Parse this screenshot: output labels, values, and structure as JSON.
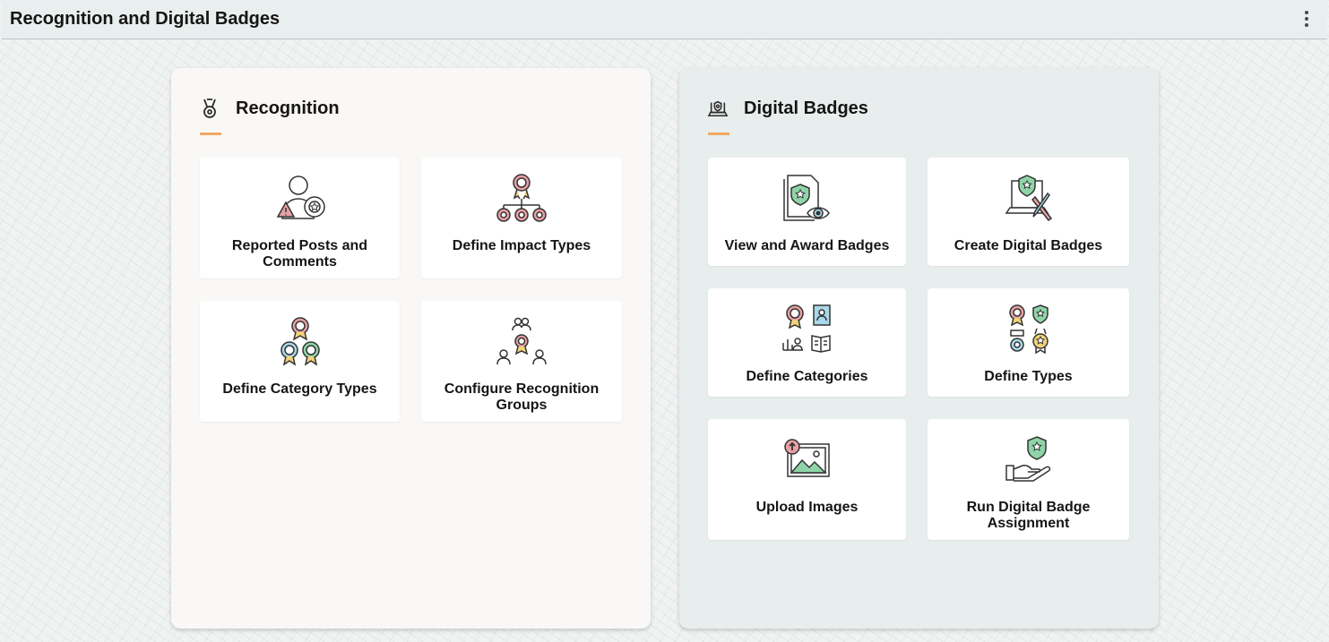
{
  "header": {
    "title": "Recognition and Digital Badges",
    "menu_icon": "kebab-menu-icon"
  },
  "recognition": {
    "title": "Recognition",
    "icon": "medal-icon",
    "tiles": [
      {
        "label": "Reported Posts and Comments",
        "icon": "reported-user-icon"
      },
      {
        "label": "Define Impact Types",
        "icon": "impact-hierarchy-icon"
      },
      {
        "label": "Define Category Types",
        "icon": "category-badges-icon"
      },
      {
        "label": "Configure Recognition Groups",
        "icon": "recognition-groups-icon"
      }
    ]
  },
  "badges": {
    "title": "Digital Badges",
    "icon": "badge-laptop-icon",
    "tiles": [
      {
        "label": "View and Award Badges",
        "icon": "view-badge-icon"
      },
      {
        "label": "Create Digital Badges",
        "icon": "create-badge-icon"
      },
      {
        "label": "Define Categories",
        "icon": "categories-icon"
      },
      {
        "label": "Define Types",
        "icon": "badge-types-icon"
      },
      {
        "label": "Upload Images",
        "icon": "upload-image-icon"
      },
      {
        "label": "Run Digital Badge Assignment",
        "icon": "badge-assignment-icon"
      }
    ]
  },
  "colors": {
    "accent": "#f0a860",
    "badge_pink": "#e8a0a4",
    "badge_green": "#8fd4a8",
    "badge_blue": "#a8d8e8",
    "badge_yellow": "#f2d37a"
  }
}
